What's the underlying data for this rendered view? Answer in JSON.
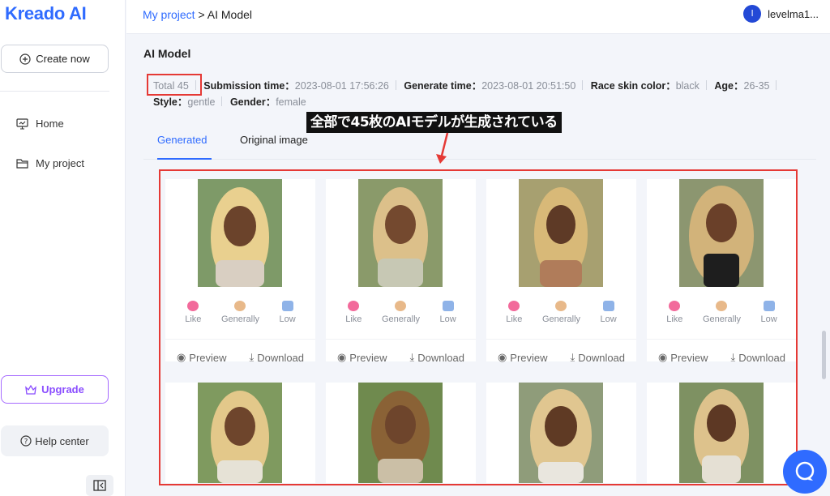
{
  "app": {
    "logo": "Kreado",
    "logo_ai": "AI"
  },
  "sidebar": {
    "create_label": "Create now",
    "items": [
      {
        "label": "Home",
        "icon": "monitor-icon"
      },
      {
        "label": "My project",
        "icon": "folder-icon"
      }
    ],
    "upgrade_label": "Upgrade",
    "help_label": "Help center"
  },
  "header": {
    "breadcrumb_root": "My project",
    "breadcrumb_sep": " > ",
    "breadcrumb_current": "AI Model",
    "avatar_initial": "l",
    "username": "levelma1..."
  },
  "main": {
    "title": "AI Model",
    "total": "Total 45",
    "meta": [
      {
        "key": "Submission time：",
        "value": "2023-08-01 17:56:26"
      },
      {
        "key": "Generate time：",
        "value": "2023-08-01 20:51:50"
      },
      {
        "key": "Race skin color：",
        "value": "black"
      },
      {
        "key": "Age：",
        "value": "26-35"
      },
      {
        "key": "Style：",
        "value": "gentle"
      },
      {
        "key": "Gender：",
        "value": "female"
      }
    ],
    "tabs": [
      "Generated",
      "Original image"
    ],
    "annotation": "全部で45枚のAIモデルが生成されている"
  },
  "card_labels": {
    "like": "Like",
    "generally": "Generally",
    "low": "Low",
    "preview": "Preview",
    "download": "Download"
  },
  "colors": {
    "accent": "#2f6bff",
    "highlight": "#e53935",
    "upgrade": "#8a4dff"
  }
}
